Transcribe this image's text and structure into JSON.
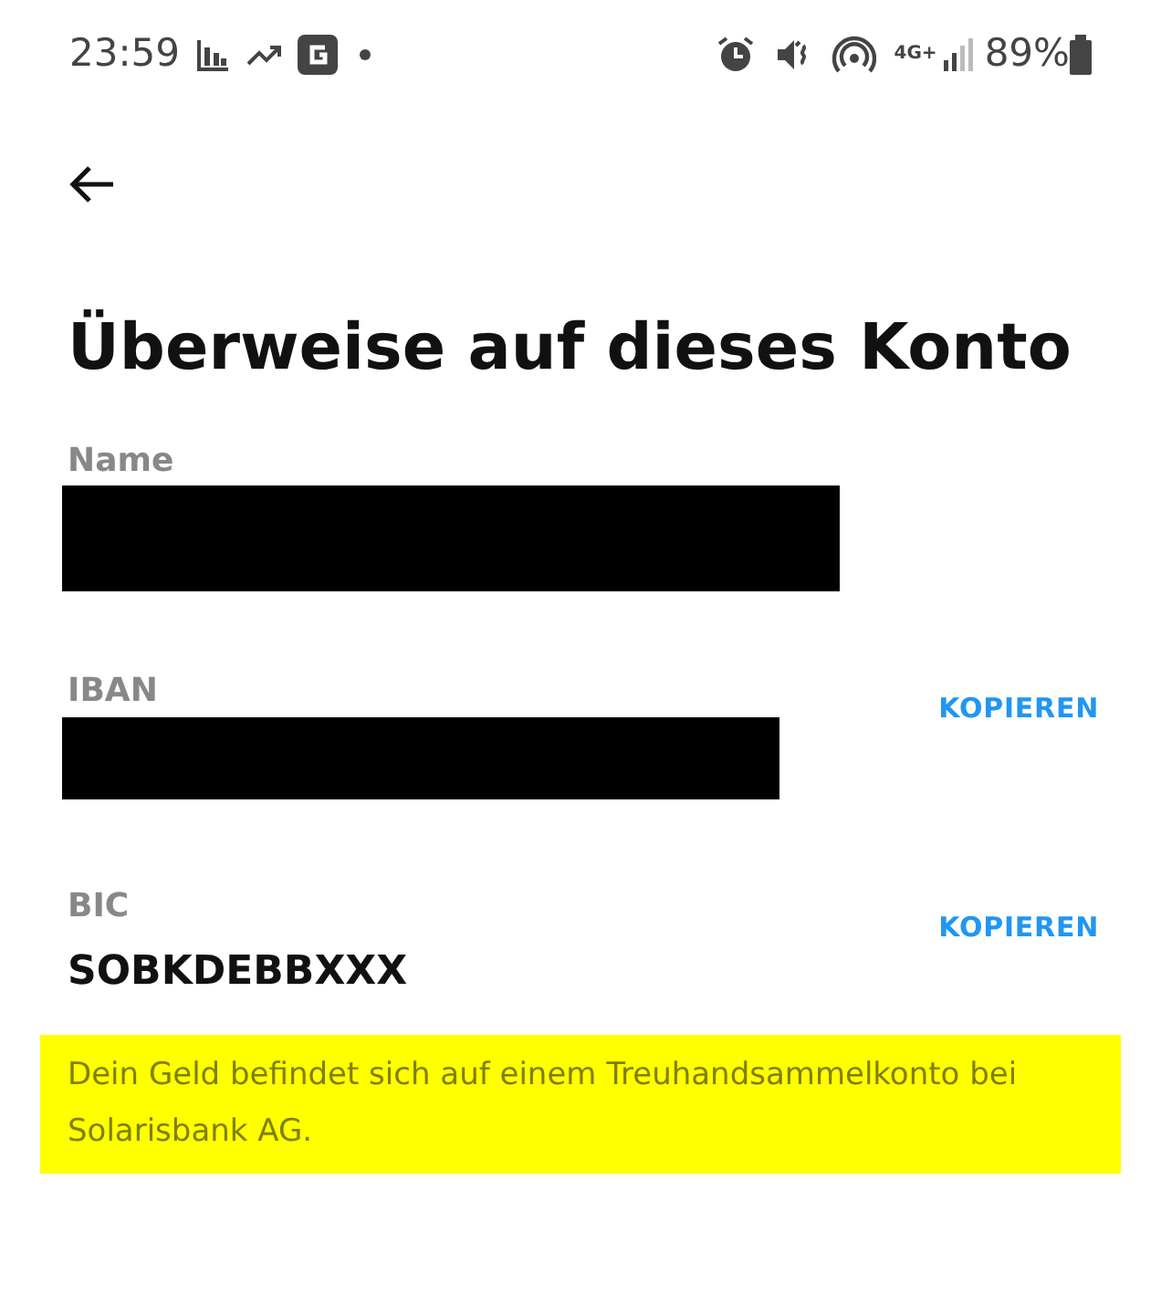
{
  "status_bar": {
    "time": "23:59",
    "battery": "89%",
    "network": "4G+"
  },
  "title": "Überweise auf dieses Konto",
  "fields": [
    {
      "label": "Name",
      "kind": "redacted"
    },
    {
      "label": "IBAN",
      "kind": "redacted",
      "action": "KOPIEREN"
    },
    {
      "label": "BIC",
      "kind": "text",
      "value": "SOBKDEBBXXX",
      "action": "KOPIEREN"
    }
  ],
  "notice": "Dein Geld befindet sich auf einem Treuhandsammelkonto bei Solarisbank AG."
}
